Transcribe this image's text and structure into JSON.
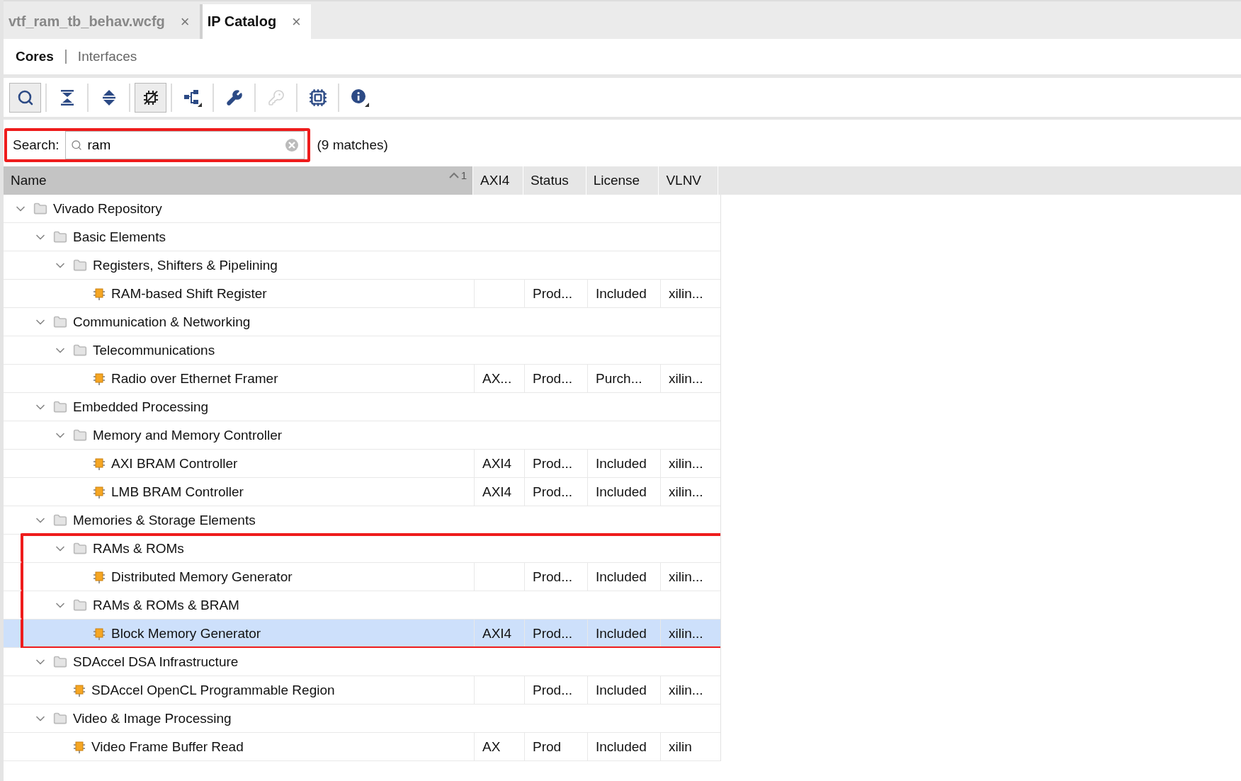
{
  "doc_tabs": [
    {
      "label": "vtf_ram_tb_behav.wcfg",
      "selected": false,
      "close": "×"
    },
    {
      "label": "IP Catalog",
      "selected": true,
      "close": "×"
    }
  ],
  "sub_tabs": [
    {
      "label": "Cores",
      "selected": true
    },
    {
      "label": "Interfaces",
      "selected": false
    }
  ],
  "toolbar": [
    {
      "kind": "search",
      "pressed": true,
      "disabled": false
    },
    {
      "kind": "collapse",
      "pressed": false,
      "disabled": false
    },
    {
      "kind": "expand",
      "pressed": false,
      "disabled": false
    },
    {
      "kind": "filter",
      "pressed": true,
      "disabled": false
    },
    {
      "kind": "hierarchy",
      "pressed": false,
      "disabled": false
    },
    {
      "kind": "wrench",
      "pressed": false,
      "disabled": false
    },
    {
      "kind": "key",
      "pressed": false,
      "disabled": true
    },
    {
      "kind": "chip",
      "pressed": false,
      "disabled": false
    },
    {
      "kind": "info",
      "pressed": false,
      "disabled": false
    }
  ],
  "search": {
    "label": "Search:",
    "value": "ram",
    "matches": "(9 matches)",
    "highlighted": true
  },
  "table": {
    "columns": [
      {
        "label": "Name",
        "sort": "1"
      },
      {
        "label": "AXI4"
      },
      {
        "label": "Status"
      },
      {
        "label": "License"
      },
      {
        "label": "VLNV"
      }
    ],
    "rows": [
      {
        "name": "Vivado Repository",
        "expanded": true,
        "selected": false,
        "highlighted": false,
        "children": [
          {
            "name": "Basic Elements",
            "expanded": true,
            "selected": false,
            "highlighted": false,
            "children": [
              {
                "name": "Registers, Shifters & Pipelining",
                "expanded": true,
                "selected": false,
                "highlighted": false,
                "children": [
                  {
                    "name": "RAM-based Shift Register",
                    "selected": false,
                    "highlighted": false,
                    "status": "Prod...",
                    "license": "Included",
                    "vlnv": "xilin..."
                  }
                ]
              }
            ]
          },
          {
            "name": "Communication & Networking",
            "expanded": true,
            "selected": false,
            "highlighted": false,
            "children": [
              {
                "name": "Telecommunications",
                "expanded": true,
                "selected": false,
                "highlighted": false,
                "children": [
                  {
                    "name": "Radio over Ethernet Framer",
                    "selected": false,
                    "highlighted": false,
                    "axi4": "AX...",
                    "status": "Prod...",
                    "license": "Purch...",
                    "vlnv": "xilin..."
                  }
                ]
              }
            ]
          },
          {
            "name": "Embedded Processing",
            "expanded": true,
            "selected": false,
            "highlighted": false,
            "children": [
              {
                "name": "Memory and Memory Controller",
                "expanded": true,
                "selected": false,
                "highlighted": false,
                "children": [
                  {
                    "name": "AXI BRAM Controller",
                    "selected": false,
                    "highlighted": false,
                    "axi4": "AXI4",
                    "status": "Prod...",
                    "license": "Included",
                    "vlnv": "xilin..."
                  },
                  {
                    "name": "LMB BRAM Controller",
                    "selected": false,
                    "highlighted": false,
                    "axi4": "AXI4",
                    "status": "Prod...",
                    "license": "Included",
                    "vlnv": "xilin..."
                  }
                ]
              }
            ]
          },
          {
            "name": "Memories & Storage Elements",
            "expanded": true,
            "selected": false,
            "highlighted": false,
            "children": [
              {
                "name": "RAMs & ROMs",
                "expanded": true,
                "selected": false,
                "highlighted": true,
                "children": [
                  {
                    "name": "Distributed Memory Generator",
                    "selected": false,
                    "highlighted": true,
                    "status": "Prod...",
                    "license": "Included",
                    "vlnv": "xilin..."
                  }
                ]
              },
              {
                "name": "RAMs & ROMs & BRAM",
                "expanded": true,
                "selected": false,
                "highlighted": true,
                "children": [
                  {
                    "name": "Block Memory Generator",
                    "selected": true,
                    "highlighted": true,
                    "axi4": "AXI4",
                    "status": "Prod...",
                    "license": "Included",
                    "vlnv": "xilin..."
                  }
                ]
              }
            ]
          },
          {
            "name": "SDAccel DSA Infrastructure",
            "expanded": true,
            "selected": false,
            "highlighted": false,
            "children": [
              {
                "name": "SDAccel OpenCL Programmable Region",
                "selected": false,
                "highlighted": false,
                "status": "Prod...",
                "license": "Included",
                "vlnv": "xilin..."
              }
            ]
          },
          {
            "name": "Video & Image Processing",
            "expanded": true,
            "selected": false,
            "highlighted": false,
            "children": [
              {
                "name": "Video Frame Buffer Read",
                "selected": false,
                "highlighted": false,
                "axi4": "AX",
                "status": "Prod",
                "license": "Included",
                "vlnv": "xilin"
              }
            ]
          }
        ]
      }
    ]
  }
}
